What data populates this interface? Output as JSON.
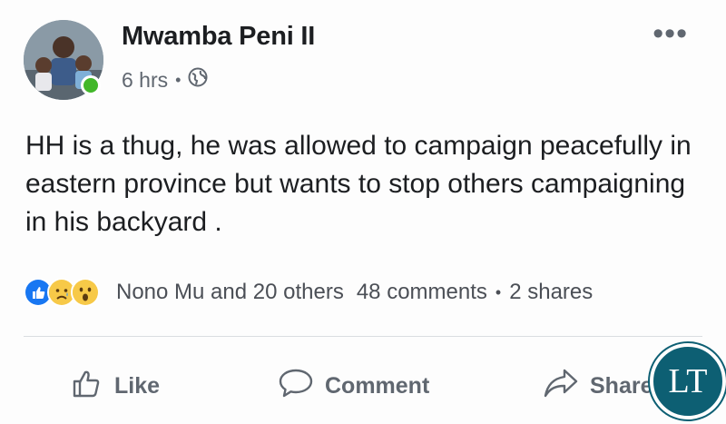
{
  "post": {
    "author": "Mwamba Peni II",
    "time": "6 hrs",
    "separator": "•",
    "privacy_icon": "globe-icon",
    "more_label": "•••",
    "text": "HH is a thug, he was allowed to campaign peacefully in eastern province but wants to stop others campaigning in his backyard ."
  },
  "reactions": {
    "icons": [
      "like-reaction-icon",
      "sad-reaction-icon",
      "wow-reaction-icon"
    ],
    "summary": "Nono Mu and 20 others",
    "comments": "48 comments",
    "dot": "•",
    "shares": "2 shares"
  },
  "actions": {
    "like": "Like",
    "comment": "Comment",
    "share": "Share"
  },
  "watermark": {
    "text": "LT"
  },
  "colors": {
    "like_blue": "#1877f2",
    "presence_green": "#42b72a",
    "muted_text": "#606770",
    "watermark_teal": "#0d5f73"
  }
}
